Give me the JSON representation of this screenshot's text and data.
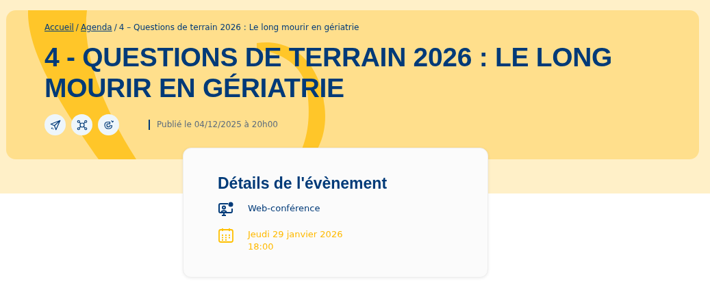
{
  "breadcrumb": [
    {
      "label": "Accueil",
      "link": true
    },
    {
      "separator": "/",
      "label": "Agenda",
      "link": true
    },
    {
      "separator": "/",
      "label": "4 – Questions de terrain 2026 : Le long mourir en gériatrie",
      "link": false
    }
  ],
  "title": "4 - QUESTIONS DE TERRAIN 2026 : LE LONG MOURIR EN GÉRIATRIE",
  "share_buttons": [
    {
      "kind": "send"
    },
    {
      "kind": "network"
    },
    {
      "kind": "magnet"
    }
  ],
  "published": "Publié le 04/12/2025 à 20h00",
  "details": {
    "heading": "Détails de l'évènement",
    "items": [
      {
        "kind": "format",
        "lines": [
          "Web-conférence"
        ]
      },
      {
        "kind": "date",
        "lines": [
          "Jeudi 29 janvier 2026",
          "18:00"
        ]
      }
    ]
  }
}
